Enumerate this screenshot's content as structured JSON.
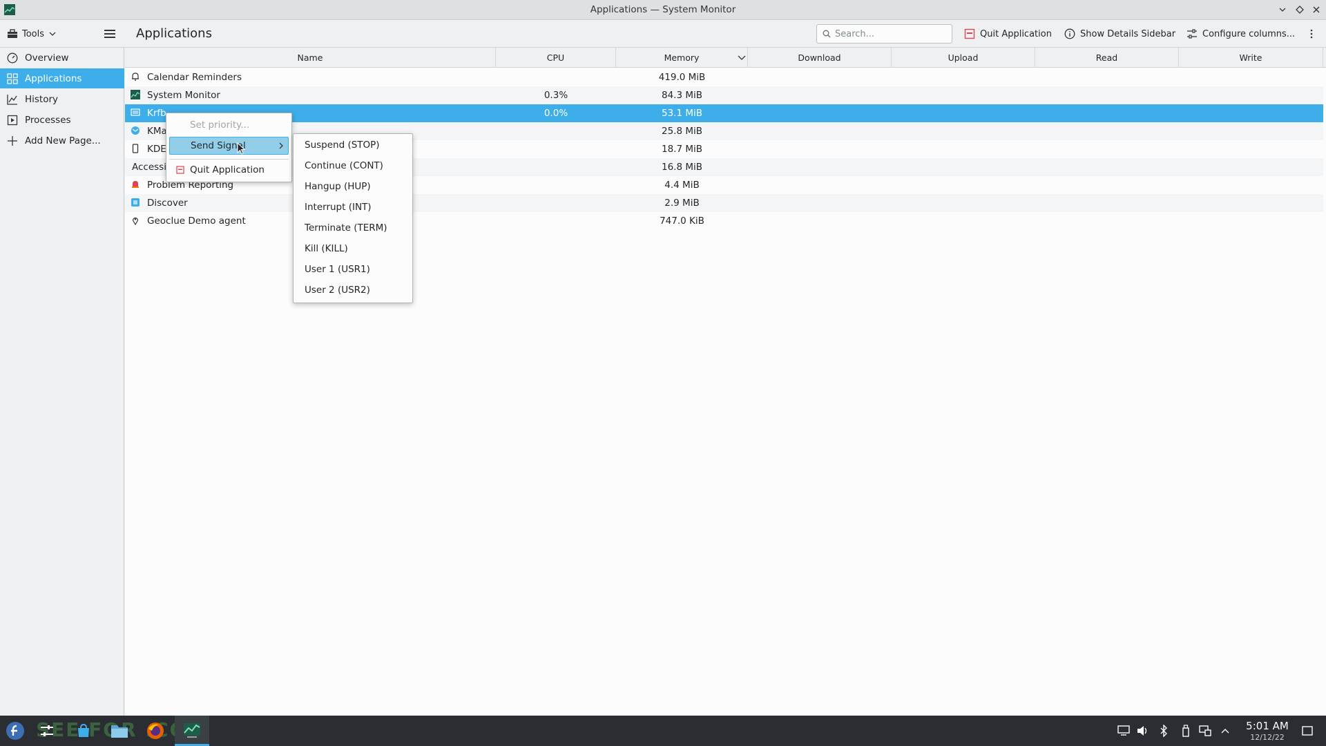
{
  "window": {
    "title": "Applications — System Monitor"
  },
  "toolbar": {
    "tools_label": "Tools",
    "page_title": "Applications",
    "search_placeholder": "Search...",
    "quit_app_label": "Quit Application",
    "show_details_label": "Show Details Sidebar",
    "configure_columns_label": "Configure columns..."
  },
  "sidebar": {
    "items": [
      {
        "label": "Overview",
        "icon": "overview-icon"
      },
      {
        "label": "Applications",
        "icon": "applications-icon",
        "active": true
      },
      {
        "label": "History",
        "icon": "history-icon"
      },
      {
        "label": "Processes",
        "icon": "processes-icon"
      },
      {
        "label": "Add New Page...",
        "icon": "plus-icon"
      }
    ]
  },
  "table": {
    "columns": [
      "Name",
      "CPU",
      "Memory",
      "Download",
      "Upload",
      "Read",
      "Write"
    ],
    "rows": [
      {
        "name": "Calendar Reminders",
        "cpu": "",
        "memory": "419.0 MiB"
      },
      {
        "name": "System Monitor",
        "cpu": "0.3%",
        "memory": "84.3 MiB"
      },
      {
        "name": "Krfb",
        "cpu": "0.0%",
        "memory": "53.1 MiB",
        "selected": true
      },
      {
        "name": "KMa",
        "cpu": "",
        "memory": "25.8 MiB"
      },
      {
        "name": "KDE",
        "cpu": "",
        "memory": "18.7 MiB"
      },
      {
        "name": "Accessi",
        "cpu": "",
        "memory": "16.8 MiB"
      },
      {
        "name": "Problem Reporting",
        "cpu": "",
        "memory": "4.4 MiB"
      },
      {
        "name": "Discover",
        "cpu": "",
        "memory": "2.9 MiB"
      },
      {
        "name": "Geoclue Demo agent",
        "cpu": "",
        "memory": "747.0 KiB"
      }
    ]
  },
  "context_menu": {
    "set_priority": "Set priority...",
    "send_signal": "Send Signal",
    "quit_application": "Quit Application"
  },
  "signal_menu": {
    "items": [
      "Suspend (STOP)",
      "Continue (CONT)",
      "Hangup (HUP)",
      "Interrupt (INT)",
      "Terminate (TERM)",
      "Kill (KILL)",
      "User 1 (USR1)",
      "User 2 (USR2)"
    ]
  },
  "taskbar": {
    "watermark": "SEE FOR .COM",
    "time": "5:01 AM",
    "date": "12/12/22"
  },
  "colors": {
    "accent": "#3daee9",
    "taskbar": "#2a2e32"
  }
}
